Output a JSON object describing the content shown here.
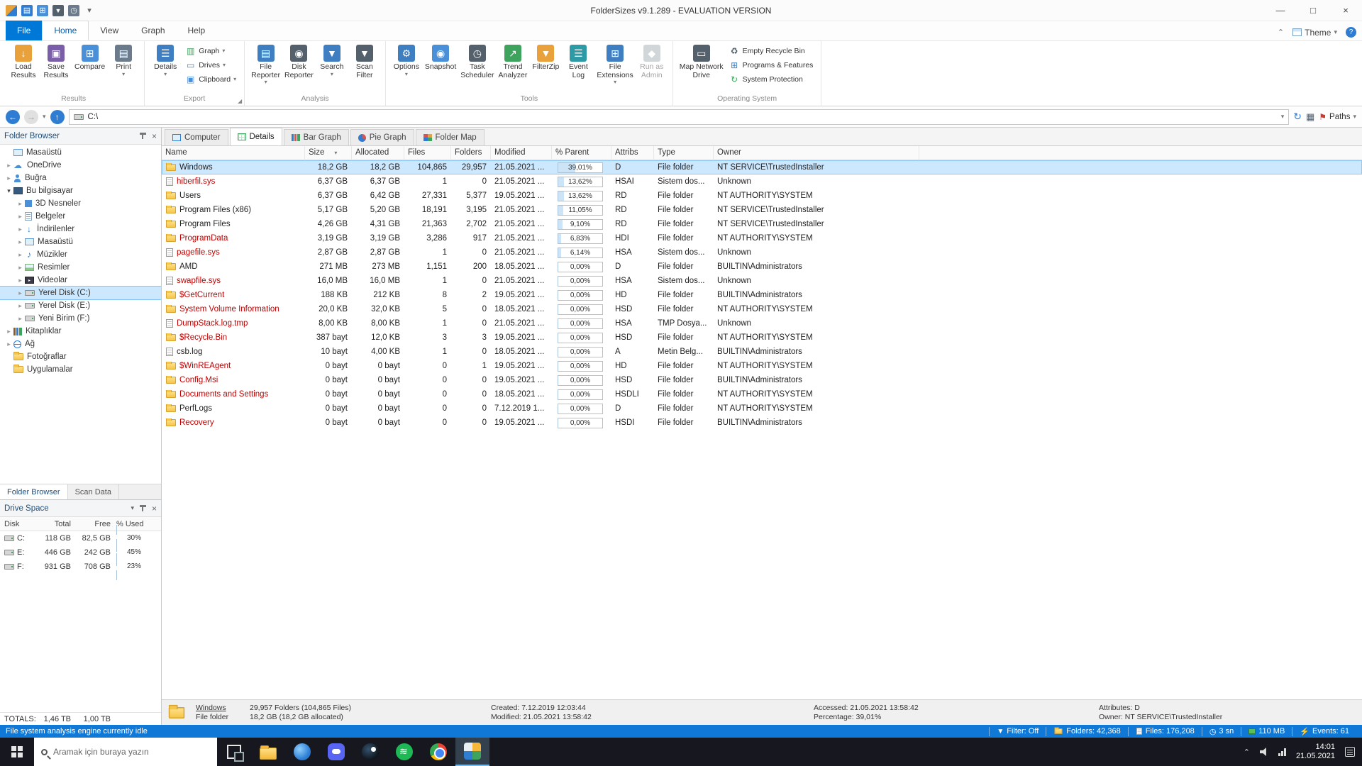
{
  "colors": {
    "accent": "#0078d7",
    "selection": "#cce8ff",
    "hidden_item_text": "#c00000",
    "status_bar": "#1079d8",
    "taskbar": "#17171f"
  },
  "titlebar": {
    "title": "FolderSizes v9.1.289 - EVALUATION VERSION",
    "quick_access": [
      "app",
      "details",
      "compare",
      "filter",
      "history",
      "customize"
    ]
  },
  "menu": {
    "tabs": [
      {
        "label": "File",
        "file": true
      },
      {
        "label": "Home",
        "active": true
      },
      {
        "label": "View"
      },
      {
        "label": "Graph"
      },
      {
        "label": "Help"
      }
    ],
    "theme_label": "Theme"
  },
  "ribbon": {
    "groups": [
      {
        "name": "Results",
        "large": [
          {
            "label": "Load\nResults",
            "icon": "load-results"
          },
          {
            "label": "Save\nResults",
            "icon": "save-results"
          },
          {
            "label": "Compare",
            "icon": "compare"
          },
          {
            "label": "Print",
            "icon": "print",
            "arrow": true
          }
        ]
      },
      {
        "name": "Export",
        "large": [
          {
            "label": "Details",
            "icon": "details",
            "arrow": true
          }
        ],
        "small": [
          {
            "label": "Graph",
            "icon": "graph",
            "arrow": true
          },
          {
            "label": "Drives",
            "icon": "drives",
            "arrow": true
          },
          {
            "label": "Clipboard",
            "icon": "clipboard",
            "arrow": true
          }
        ],
        "launcher": true
      },
      {
        "name": "Analysis",
        "large": [
          {
            "label": "File\nReporter",
            "icon": "file-reporter",
            "arrow": true
          },
          {
            "label": "Disk\nReporter",
            "icon": "disk-reporter"
          },
          {
            "label": "Search",
            "icon": "search",
            "arrow": true
          },
          {
            "label": "Scan\nFilter",
            "icon": "scan-filter"
          }
        ]
      },
      {
        "name": "Tools",
        "large": [
          {
            "label": "Options",
            "icon": "options",
            "arrow": true
          },
          {
            "label": "Snapshot",
            "icon": "snapshot"
          },
          {
            "label": "Task\nScheduler",
            "icon": "task-scheduler"
          },
          {
            "label": "Trend\nAnalyzer",
            "icon": "trend-analyzer"
          },
          {
            "label": "FilterZip",
            "icon": "filterzip"
          },
          {
            "label": "Event\nLog",
            "icon": "event-log"
          },
          {
            "label": "File\nExtensions",
            "icon": "file-extensions",
            "arrow": true
          },
          {
            "label": "Run as\nAdmin",
            "icon": "run-admin",
            "disabled": true
          }
        ]
      },
      {
        "name": "Operating System",
        "large": [
          {
            "label": "Map Network\nDrive",
            "icon": "map-drive"
          }
        ],
        "small": [
          {
            "label": "Empty Recycle Bin",
            "icon": "recycle-bin"
          },
          {
            "label": "Programs & Features",
            "icon": "programs"
          },
          {
            "label": "System Protection",
            "icon": "protection"
          }
        ]
      }
    ]
  },
  "addressbar": {
    "path": "C:\\",
    "paths_label": "Paths"
  },
  "folder_browser": {
    "title": "Folder Browser",
    "items": [
      {
        "label": "Masaüstü",
        "icon": "desktop",
        "level": 0,
        "expand": "none"
      },
      {
        "label": "OneDrive",
        "icon": "cloud",
        "level": 0,
        "expand": "collapsed"
      },
      {
        "label": "Buğra",
        "icon": "user",
        "level": 0,
        "expand": "collapsed"
      },
      {
        "label": "Bu bilgisayar",
        "icon": "computer",
        "level": 0,
        "expand": "expanded"
      },
      {
        "label": "3D Nesneler",
        "icon": "cube",
        "level": 1,
        "expand": "collapsed"
      },
      {
        "label": "Belgeler",
        "icon": "documents",
        "level": 1,
        "expand": "collapsed"
      },
      {
        "label": "İndirilenler",
        "icon": "downloads",
        "level": 1,
        "expand": "collapsed"
      },
      {
        "label": "Masaüstü",
        "icon": "desktop",
        "level": 1,
        "expand": "collapsed"
      },
      {
        "label": "Müzikler",
        "icon": "music",
        "level": 1,
        "expand": "collapsed"
      },
      {
        "label": "Resimler",
        "icon": "pictures",
        "level": 1,
        "expand": "collapsed"
      },
      {
        "label": "Videolar",
        "icon": "videos",
        "level": 1,
        "expand": "collapsed"
      },
      {
        "label": "Yerel Disk (C:)",
        "icon": "drive",
        "level": 1,
        "expand": "collapsed",
        "selected": true
      },
      {
        "label": "Yerel Disk (E:)",
        "icon": "drive",
        "level": 1,
        "expand": "collapsed"
      },
      {
        "label": "Yeni Birim (F:)",
        "icon": "drive",
        "level": 1,
        "expand": "collapsed"
      },
      {
        "label": "Kitaplıklar",
        "icon": "library",
        "level": 0,
        "expand": "collapsed"
      },
      {
        "label": "Ağ",
        "icon": "network",
        "level": 0,
        "expand": "collapsed"
      },
      {
        "label": "Fotoğraflar",
        "icon": "folder",
        "level": 0,
        "expand": "none"
      },
      {
        "label": "Uygulamalar",
        "icon": "folder",
        "level": 0,
        "expand": "none"
      }
    ],
    "bottom_tabs": [
      {
        "label": "Folder Browser",
        "active": true
      },
      {
        "label": "Scan Data"
      }
    ]
  },
  "drive_space": {
    "title": "Drive Space",
    "columns": [
      "Disk",
      "Total",
      "Free",
      "% Used"
    ],
    "rows": [
      {
        "disk": "C:",
        "total": "118 GB",
        "free": "82,5 GB",
        "used_pct": "30%",
        "used_val": 30
      },
      {
        "disk": "E:",
        "total": "446 GB",
        "free": "242 GB",
        "used_pct": "45%",
        "used_val": 45
      },
      {
        "disk": "F:",
        "total": "931 GB",
        "free": "708 GB",
        "used_pct": "23%",
        "used_val": 23
      }
    ],
    "totals_label": "TOTALS:",
    "totals_total": "1,46 TB",
    "totals_free": "1,00 TB"
  },
  "view_tabs": [
    {
      "label": "Computer",
      "icon": "computer"
    },
    {
      "label": "Details",
      "icon": "details",
      "active": true
    },
    {
      "label": "Bar Graph",
      "icon": "bar-graph"
    },
    {
      "label": "Pie Graph",
      "icon": "pie-graph"
    },
    {
      "label": "Folder Map",
      "icon": "folder-map"
    }
  ],
  "table": {
    "columns": [
      {
        "label": "Name"
      },
      {
        "label": "Size",
        "sort": "desc"
      },
      {
        "label": "Allocated"
      },
      {
        "label": "Files"
      },
      {
        "label": "Folders"
      },
      {
        "label": "Modified"
      },
      {
        "label": "% Parent"
      },
      {
        "label": "Attribs"
      },
      {
        "label": "Type"
      },
      {
        "label": "Owner"
      }
    ],
    "rows": [
      {
        "name": "Windows",
        "icon": "folder",
        "red": false,
        "selected": true,
        "size": "18,2 GB",
        "alloc": "18,2 GB",
        "files": "104,865",
        "folders": "29,957",
        "mod": "21.05.2021 ...",
        "pct": "39,01%",
        "pv": 39.01,
        "attr": "D",
        "type": "File folder",
        "owner": "NT SERVICE\\TrustedInstaller"
      },
      {
        "name": "hiberfil.sys",
        "icon": "file",
        "red": true,
        "size": "6,37 GB",
        "alloc": "6,37 GB",
        "files": "1",
        "folders": "0",
        "mod": "21.05.2021 ...",
        "pct": "13,62%",
        "pv": 13.62,
        "attr": "HSAI",
        "type": "Sistem dos...",
        "owner": "Unknown"
      },
      {
        "name": "Users",
        "icon": "folder",
        "red": false,
        "size": "6,37 GB",
        "alloc": "6,42 GB",
        "files": "27,331",
        "folders": "5,377",
        "mod": "19.05.2021 ...",
        "pct": "13,62%",
        "pv": 13.62,
        "attr": "RD",
        "type": "File folder",
        "owner": "NT AUTHORITY\\SYSTEM"
      },
      {
        "name": "Program Files (x86)",
        "icon": "folder",
        "red": false,
        "size": "5,17 GB",
        "alloc": "5,20 GB",
        "files": "18,191",
        "folders": "3,195",
        "mod": "21.05.2021 ...",
        "pct": "11,05%",
        "pv": 11.05,
        "attr": "RD",
        "type": "File folder",
        "owner": "NT SERVICE\\TrustedInstaller"
      },
      {
        "name": "Program Files",
        "icon": "folder",
        "red": false,
        "size": "4,26 GB",
        "alloc": "4,31 GB",
        "files": "21,363",
        "folders": "2,702",
        "mod": "21.05.2021 ...",
        "pct": "9,10%",
        "pv": 9.1,
        "attr": "RD",
        "type": "File folder",
        "owner": "NT SERVICE\\TrustedInstaller"
      },
      {
        "name": "ProgramData",
        "icon": "folder",
        "red": true,
        "size": "3,19 GB",
        "alloc": "3,19 GB",
        "files": "3,286",
        "folders": "917",
        "mod": "21.05.2021 ...",
        "pct": "6,83%",
        "pv": 6.83,
        "attr": "HDI",
        "type": "File folder",
        "owner": "NT AUTHORITY\\SYSTEM"
      },
      {
        "name": "pagefile.sys",
        "icon": "file",
        "red": true,
        "size": "2,87 GB",
        "alloc": "2,87 GB",
        "files": "1",
        "folders": "0",
        "mod": "21.05.2021 ...",
        "pct": "6,14%",
        "pv": 6.14,
        "attr": "HSA",
        "type": "Sistem dos...",
        "owner": "Unknown"
      },
      {
        "name": "AMD",
        "icon": "folder",
        "red": false,
        "size": "271 MB",
        "alloc": "273 MB",
        "files": "1,151",
        "folders": "200",
        "mod": "18.05.2021 ...",
        "pct": "0,00%",
        "pv": 0,
        "attr": "D",
        "type": "File folder",
        "owner": "BUILTIN\\Administrators"
      },
      {
        "name": "swapfile.sys",
        "icon": "file",
        "red": true,
        "size": "16,0 MB",
        "alloc": "16,0 MB",
        "files": "1",
        "folders": "0",
        "mod": "21.05.2021 ...",
        "pct": "0,00%",
        "pv": 0,
        "attr": "HSA",
        "type": "Sistem dos...",
        "owner": "Unknown"
      },
      {
        "name": "$GetCurrent",
        "icon": "folder",
        "red": true,
        "size": "188 KB",
        "alloc": "212 KB",
        "files": "8",
        "folders": "2",
        "mod": "19.05.2021 ...",
        "pct": "0,00%",
        "pv": 0,
        "attr": "HD",
        "type": "File folder",
        "owner": "BUILTIN\\Administrators"
      },
      {
        "name": "System Volume Information",
        "icon": "folder",
        "red": true,
        "size": "20,0 KB",
        "alloc": "32,0 KB",
        "files": "5",
        "folders": "0",
        "mod": "18.05.2021 ...",
        "pct": "0,00%",
        "pv": 0,
        "attr": "HSD",
        "type": "File folder",
        "owner": "NT AUTHORITY\\SYSTEM"
      },
      {
        "name": "DumpStack.log.tmp",
        "icon": "file",
        "red": true,
        "size": "8,00 KB",
        "alloc": "8,00 KB",
        "files": "1",
        "folders": "0",
        "mod": "21.05.2021 ...",
        "pct": "0,00%",
        "pv": 0,
        "attr": "HSA",
        "type": "TMP Dosya...",
        "owner": "Unknown"
      },
      {
        "name": "$Recycle.Bin",
        "icon": "folder",
        "red": true,
        "size": "387 bayt",
        "alloc": "12,0 KB",
        "files": "3",
        "folders": "3",
        "mod": "19.05.2021 ...",
        "pct": "0,00%",
        "pv": 0,
        "attr": "HSD",
        "type": "File folder",
        "owner": "NT AUTHORITY\\SYSTEM"
      },
      {
        "name": "csb.log",
        "icon": "file",
        "red": false,
        "size": "10 bayt",
        "alloc": "4,00 KB",
        "files": "1",
        "folders": "0",
        "mod": "18.05.2021 ...",
        "pct": "0,00%",
        "pv": 0,
        "attr": "A",
        "type": "Metin Belg...",
        "owner": "BUILTIN\\Administrators"
      },
      {
        "name": "$WinREAgent",
        "icon": "folder",
        "red": true,
        "size": "0 bayt",
        "alloc": "0 bayt",
        "files": "0",
        "folders": "1",
        "mod": "19.05.2021 ...",
        "pct": "0,00%",
        "pv": 0,
        "attr": "HD",
        "type": "File folder",
        "owner": "NT AUTHORITY\\SYSTEM"
      },
      {
        "name": "Config.Msi",
        "icon": "folder",
        "red": true,
        "size": "0 bayt",
        "alloc": "0 bayt",
        "files": "0",
        "folders": "0",
        "mod": "19.05.2021 ...",
        "pct": "0,00%",
        "pv": 0,
        "attr": "HSD",
        "type": "File folder",
        "owner": "BUILTIN\\Administrators"
      },
      {
        "name": "Documents and Settings",
        "icon": "folder",
        "red": true,
        "size": "0 bayt",
        "alloc": "0 bayt",
        "files": "0",
        "folders": "0",
        "mod": "18.05.2021 ...",
        "pct": "0,00%",
        "pv": 0,
        "attr": "HSDLI",
        "type": "File folder",
        "owner": "NT AUTHORITY\\SYSTEM"
      },
      {
        "name": "PerfLogs",
        "icon": "folder",
        "red": false,
        "size": "0 bayt",
        "alloc": "0 bayt",
        "files": "0",
        "folders": "0",
        "mod": "7.12.2019 1...",
        "pct": "0,00%",
        "pv": 0,
        "attr": "D",
        "type": "File folder",
        "owner": "NT AUTHORITY\\SYSTEM"
      },
      {
        "name": "Recovery",
        "icon": "folder",
        "red": true,
        "size": "0 bayt",
        "alloc": "0 bayt",
        "files": "0",
        "folders": "0",
        "mod": "19.05.2021 ...",
        "pct": "0,00%",
        "pv": 0,
        "attr": "HSDI",
        "type": "File folder",
        "owner": "BUILTIN\\Administrators"
      }
    ]
  },
  "detail_bar": {
    "name": "Windows",
    "type": "File folder",
    "folders_files": "29,957 Folders (104,865 Files)",
    "size_alloc": "18,2 GB (18,2 GB allocated)",
    "created": "Created: 7.12.2019 12:03:44",
    "modified": "Modified: 21.05.2021 13:58:42",
    "accessed": "Accessed: 21.05.2021 13:58:42",
    "percentage": "Percentage: 39,01%",
    "attributes": "Attributes: D",
    "owner": "Owner: NT SERVICE\\TrustedInstaller"
  },
  "statusbar": {
    "message": "File system analysis engine currently idle",
    "items": [
      {
        "label": "Filter: Off",
        "icon": "filter"
      },
      {
        "label": "Folders: 42,368",
        "icon": "folders"
      },
      {
        "label": "Files: 176,208",
        "icon": "files"
      },
      {
        "label": "3 sn",
        "icon": "time"
      },
      {
        "label": "110 MB",
        "icon": "memory"
      },
      {
        "label": "Events: 61",
        "icon": "events"
      }
    ]
  },
  "taskbar": {
    "search_placeholder": "Aramak için buraya yazın",
    "apps": [
      {
        "name": "task-view"
      },
      {
        "name": "file-explorer"
      },
      {
        "name": "edge"
      },
      {
        "name": "discord"
      },
      {
        "name": "steam"
      },
      {
        "name": "spotify"
      },
      {
        "name": "chrome"
      },
      {
        "name": "foldersizes",
        "active": true
      }
    ],
    "tray": {
      "time": "14:01",
      "date": "21.05.2021"
    }
  }
}
